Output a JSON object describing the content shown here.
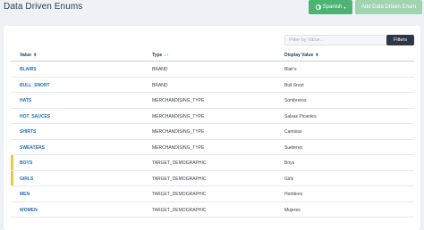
{
  "header": {
    "title": "Data Driven Enums",
    "language_label": "Spanish",
    "language_caret": "▾",
    "add_label": "Add Data Driven Enum"
  },
  "toolbar": {
    "filter_placeholder": "Filter by Value...",
    "filter_value": "",
    "filters_label": "Filters"
  },
  "table": {
    "columns": [
      {
        "label": "Value",
        "sort_icon": "⬍"
      },
      {
        "label": "Type",
        "sort_icon": "↓↑"
      },
      {
        "label": "Display Value",
        "sort_icon": "⬍"
      }
    ],
    "rows": [
      {
        "value": "BLAIRS",
        "type": "BRAND",
        "display": "Blair's",
        "highlight": false
      },
      {
        "value": "BULL_SNORT",
        "type": "BRAND",
        "display": "Bull Snort",
        "highlight": false
      },
      {
        "value": "HATS",
        "type": "MERCHANDISING_TYPE",
        "display": "Sombreros",
        "highlight": false
      },
      {
        "value": "HOT_SAUCES",
        "type": "MERCHANDISING_TYPE",
        "display": "Salsas Picantes",
        "highlight": false
      },
      {
        "value": "SHIRTS",
        "type": "MERCHANDISING_TYPE",
        "display": "Camisas",
        "highlight": false
      },
      {
        "value": "SWEATERS",
        "type": "MERCHANDISING_TYPE",
        "display": "Suéteres",
        "highlight": false
      },
      {
        "value": "BOYS",
        "type": "TARGET_DEMOGRAPHIC",
        "display": "Boys",
        "highlight": true
      },
      {
        "value": "GIRLS",
        "type": "TARGET_DEMOGRAPHIC",
        "display": "Girls",
        "highlight": true
      },
      {
        "value": "MEN",
        "type": "TARGET_DEMOGRAPHIC",
        "display": "Hombres",
        "highlight": false
      },
      {
        "value": "WOMEN",
        "type": "TARGET_DEMOGRAPHIC",
        "display": "Mujeres",
        "highlight": false
      }
    ]
  },
  "colors": {
    "primary_green": "#4db372",
    "link_blue": "#1f6fb2",
    "highlight_marker": "#e7c94b",
    "dark_button": "#2c3848"
  }
}
